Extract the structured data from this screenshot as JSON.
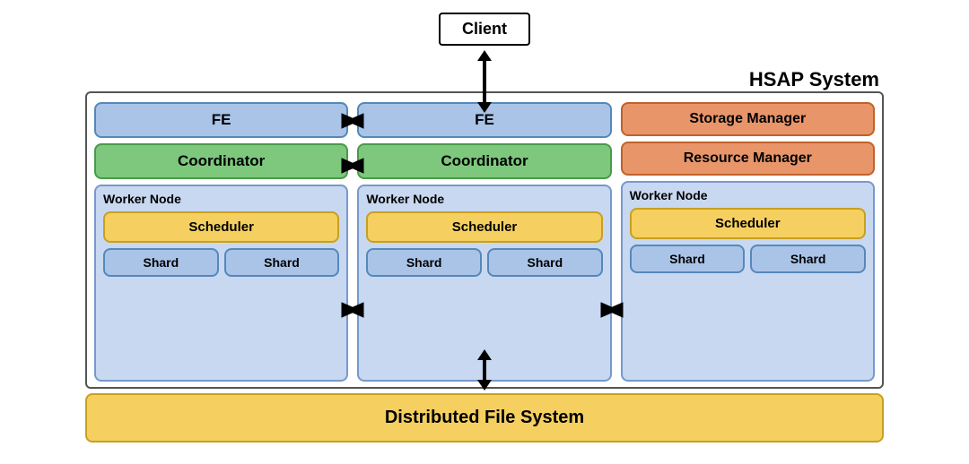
{
  "title": "HSAP System",
  "client": {
    "label": "Client"
  },
  "system": {
    "label": "HSAP System",
    "fe_left": "FE",
    "fe_mid": "FE",
    "coordinator_left": "Coordinator",
    "coordinator_mid": "Coordinator",
    "storage_manager": "Storage Manager",
    "resource_manager": "Resource Manager",
    "worker_node_label": "Worker Node",
    "scheduler_label": "Scheduler",
    "shard_label": "Shard"
  },
  "dfs": {
    "label": "Distributed File System"
  }
}
